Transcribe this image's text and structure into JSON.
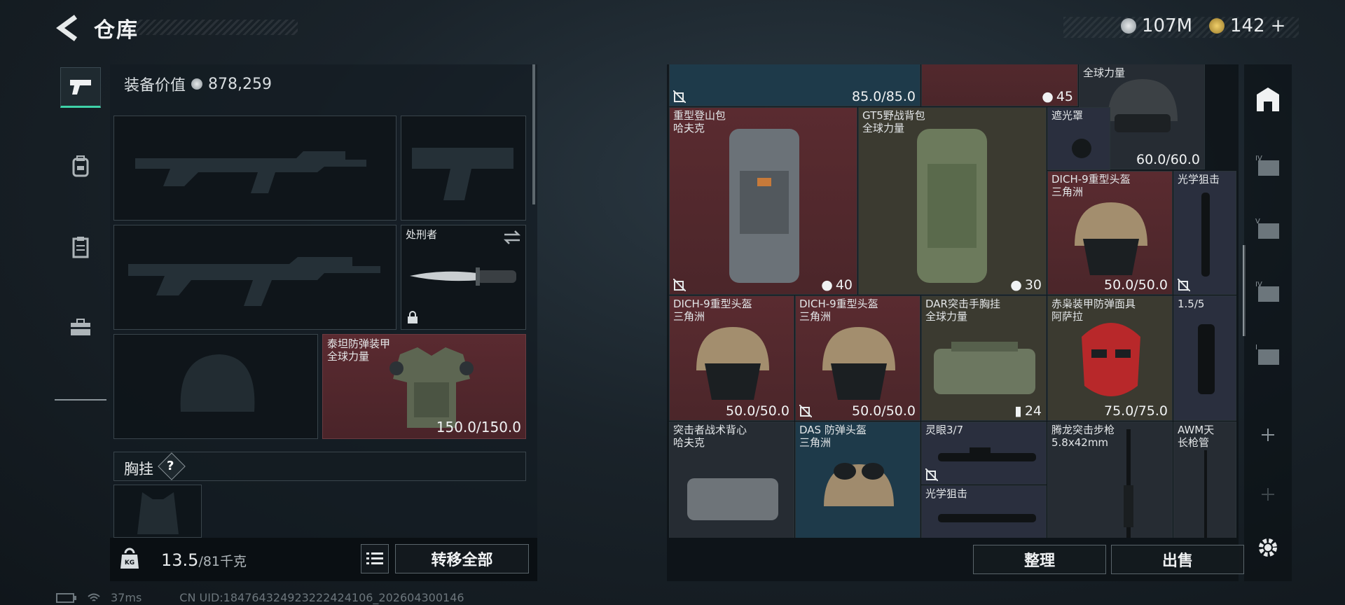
{
  "header": {
    "title": "仓库",
    "back_icon": "back-arrow-icon",
    "currencies": [
      {
        "icon": "silver-coin-icon",
        "value": "107M",
        "color": "#b9c0c4"
      },
      {
        "icon": "gold-coin-icon",
        "value": "142",
        "plus": "+",
        "color": "#c9a44a"
      }
    ]
  },
  "left": {
    "equip_value_label": "装备价值",
    "equip_value": "878,259",
    "side_tabs": [
      "pistol-icon",
      "backpack-icon",
      "clipboard-icon",
      "toolbox-icon"
    ],
    "melee": {
      "name": "处刑者"
    },
    "armor": {
      "name_line1": "泰坦防弹装甲",
      "name_line2": "全球力量",
      "durability": "150.0/150.0"
    },
    "chest_rig_label": "胸挂",
    "chest_rig_help": "?",
    "weight_value": "13.5",
    "weight_max": "/81千克",
    "transfer_all": "转移全部"
  },
  "grid": {
    "items": [
      {
        "id": "r0a",
        "name": "",
        "dur": "85.0/85.0"
      },
      {
        "id": "r0b",
        "name": "",
        "count": "45"
      },
      {
        "id": "r0c",
        "name": "全球力量",
        "dur": "60.0/60.0"
      },
      {
        "id": "hb",
        "name1": "重型登山包",
        "name2": "哈夫克",
        "count": "40"
      },
      {
        "id": "gt5",
        "name1": "GT5野战背包",
        "name2": "全球力量",
        "count": "30"
      },
      {
        "id": "shade",
        "name1": "遮光罩"
      },
      {
        "id": "dich1",
        "name1": "DICH-9重型头盔",
        "name2": "三角洲",
        "dur": "50.0/50.0"
      },
      {
        "id": "scope1",
        "name1": "光学狙击"
      },
      {
        "id": "dich2",
        "name1": "DICH-9重型头盔",
        "name2": "三角洲",
        "dur": "50.0/50.0"
      },
      {
        "id": "dich3",
        "name1": "DICH-9重型头盔",
        "name2": "三角洲",
        "dur": "50.0/50.0"
      },
      {
        "id": "dar",
        "name1": "DAR突击手胸挂",
        "name2": "全球力量",
        "count": "24"
      },
      {
        "id": "mask",
        "name1": "赤枭装甲防弹面具",
        "name2": "阿萨拉",
        "dur": "75.0/75.0"
      },
      {
        "id": "x15",
        "name1": "1.5/5"
      },
      {
        "id": "raider",
        "name1": "突击者战术背心",
        "name2": "哈夫克"
      },
      {
        "id": "das",
        "name1": "DAS 防弹头盔",
        "name2": "三角洲"
      },
      {
        "id": "lingyan",
        "name1": "灵眼3/7"
      },
      {
        "id": "scope2",
        "name1": "光学狙击"
      },
      {
        "id": "tenglong",
        "name1": "腾龙突击步枪",
        "name2": "5.8x42mm"
      },
      {
        "id": "awm",
        "name1": "AWM天",
        "name2": "长枪管"
      }
    ]
  },
  "actions": {
    "sort": "整理",
    "sell": "出售"
  },
  "status": {
    "ping": "37ms",
    "uid": "CN UID:184764324923222424106_202604300146"
  },
  "colors": {
    "accent": "#3fd2a8",
    "red_slot": "#5a2a30"
  }
}
